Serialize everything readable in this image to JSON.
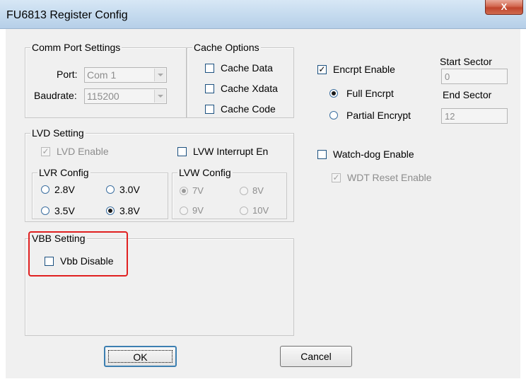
{
  "window": {
    "title": "FU6813 Register Config",
    "close_label": "X"
  },
  "comm_port": {
    "legend": "Comm Port Settings",
    "port_label": "Port:",
    "port_value": "Com 1",
    "baudrate_label": "Baudrate:",
    "baudrate_value": "115200"
  },
  "cache": {
    "legend": "Cache Options",
    "items": [
      {
        "label": "Cache Data",
        "checked": false
      },
      {
        "label": "Cache Xdata",
        "checked": false
      },
      {
        "label": "Cache Code",
        "checked": false
      }
    ]
  },
  "encrypt": {
    "enable_label": "Encrpt Enable",
    "enable_checked": true,
    "full_label": "Full Encrpt",
    "partial_label": "Partial Encrypt",
    "selected": "full",
    "start_sector_label": "Start Sector",
    "start_sector_value": "0",
    "end_sector_label": "End Sector",
    "end_sector_value": "12"
  },
  "lvd": {
    "legend": "LVD Setting",
    "enable_label": "LVD Enable",
    "enable_checked": true,
    "lvw_interrupt_label": "LVW Interrupt En",
    "lvw_interrupt_checked": false,
    "lvr": {
      "legend": "LVR Config",
      "options": [
        "2.8V",
        "3.0V",
        "3.5V",
        "3.8V"
      ],
      "selected": "3.8V"
    },
    "lvw": {
      "legend": "LVW Config",
      "options": [
        "7V",
        "8V",
        "9V",
        "10V"
      ],
      "selected": "7V"
    }
  },
  "watchdog": {
    "enable_label": "Watch-dog Enable",
    "enable_checked": false,
    "wdt_reset_label": "WDT Reset Enable",
    "wdt_reset_checked": true
  },
  "vbb": {
    "legend": "VBB Setting",
    "disable_label": "Vbb Disable",
    "disable_checked": false
  },
  "buttons": {
    "ok": "OK",
    "cancel": "Cancel"
  },
  "colors": {
    "highlight": "#e02020",
    "titlebar": "#c4daee",
    "close": "#c0452c"
  }
}
